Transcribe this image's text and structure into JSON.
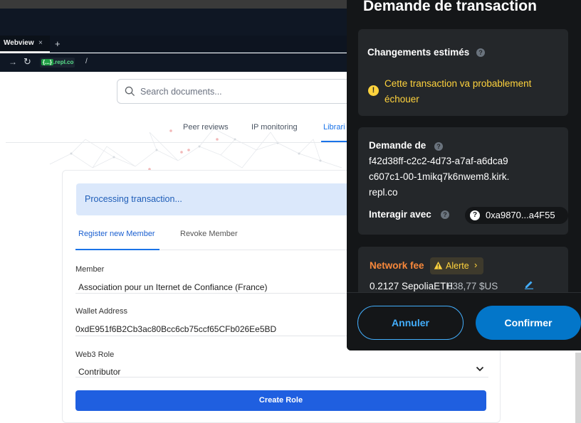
{
  "browser": {
    "tab_label": "Webview",
    "tab_close": "×",
    "tab_add": "+",
    "url_badge": "{...}",
    "url_host": ".repl.co",
    "url_path": "/"
  },
  "page": {
    "search_placeholder": "Search documents...",
    "nav_tabs": [
      "Peer reviews",
      "IP monitoring",
      "Librari"
    ],
    "status_message": "Processing transaction...",
    "form_tabs": [
      "Register new Member",
      "Revoke Member"
    ],
    "member_label": "Member",
    "member_value": "Association pour un Iternet de Confiance (France)",
    "wallet_label": "Wallet Address",
    "wallet_value": "0xdE951f6B2Cb3ac80Bcc6cb75ccf65CFb026Ee5BD",
    "role_label": "Web3 Role",
    "role_value": "Contributor",
    "create_button": "Create Role"
  },
  "metamask": {
    "title": "Demande de transaction",
    "estimated_changes": {
      "heading": "Changements estimés",
      "warning": "Cette transaction va probablement échouer"
    },
    "request": {
      "heading": "Demande de",
      "origin": "f42d38ff-c2c2-4d73-a7af-a6dca9c607c1-00-1mikq7k6nwem8.kirk.repl.co",
      "interact_label": "Interagir avec",
      "contract_address": "0xa9870...a4F55"
    },
    "network_fee": {
      "label": "Network fee",
      "alert": "Alerte",
      "amount": "0.2127 SepoliaETH",
      "fiat": "838,77 $US"
    },
    "cancel_button": "Annuler",
    "confirm_button": "Confirmer"
  },
  "colors": {
    "metamask_bg": "#141618",
    "panel_bg": "#24272a",
    "warning_yellow": "#ffd33d",
    "fee_orange": "#f8883b",
    "confirm_blue": "#0376c9",
    "primary_blue": "#1f5fe0"
  }
}
